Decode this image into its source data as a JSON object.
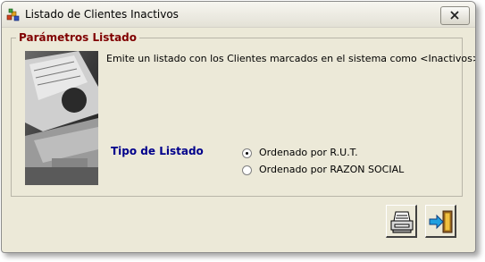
{
  "window": {
    "title": "Listado de Clientes Inactivos",
    "close_icon": "close-icon",
    "app_icon": "app-icon"
  },
  "group": {
    "legend": "Parámetros Listado",
    "description": "Emite un listado con los Clientes marcados en el sistema como <Inactivos>.",
    "tipo_label": "Tipo de Listado",
    "options": [
      {
        "label": "Ordenado por R.U.T.",
        "selected": true
      },
      {
        "label": "Ordenado por RAZON SOCIAL",
        "selected": false
      }
    ]
  },
  "toolbar": {
    "print_icon": "printer-icon",
    "exit_icon": "exit-door-icon"
  },
  "colors": {
    "legend": "#800000",
    "tipo_label": "#00008b",
    "window_bg": "#ece9d8"
  }
}
